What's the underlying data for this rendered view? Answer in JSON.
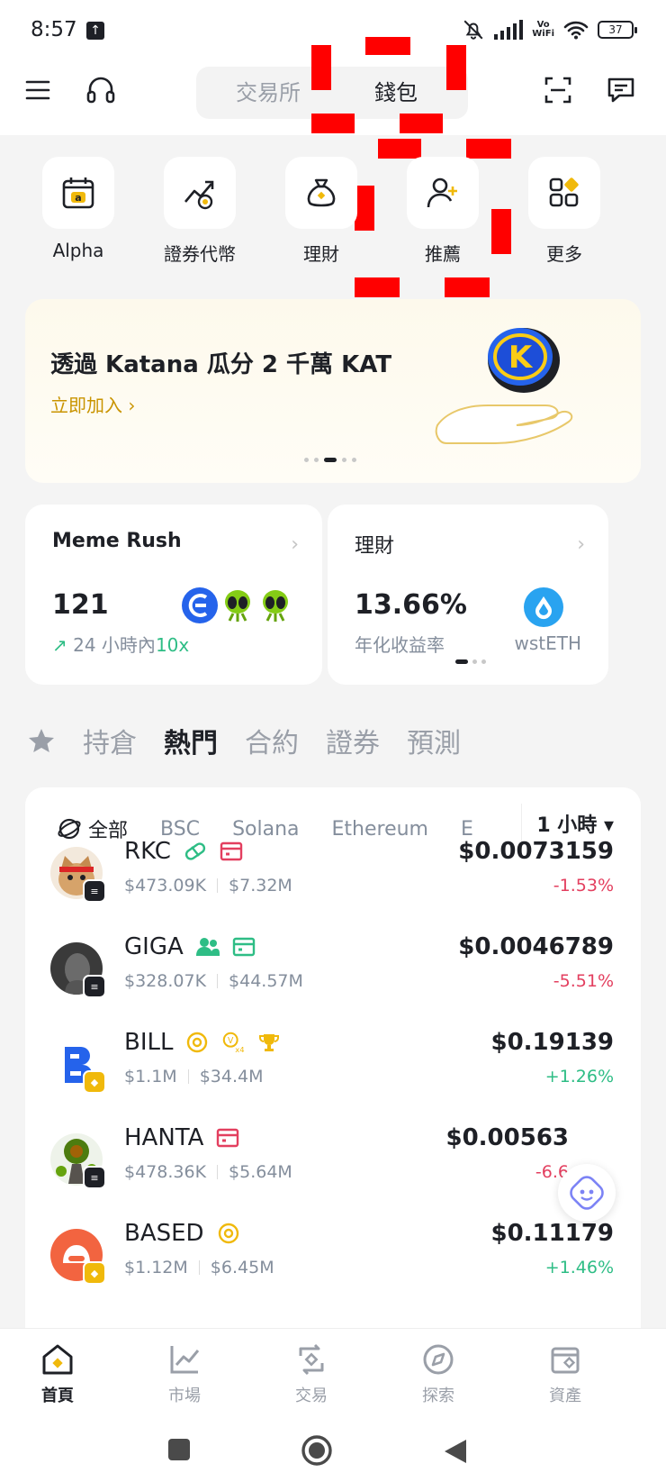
{
  "status_bar": {
    "time": "8:57",
    "vowifi_top": "Vo",
    "vowifi_bottom": "WiFi",
    "battery": "37"
  },
  "header": {
    "tabs": [
      "交易所",
      "錢包"
    ],
    "active_tab": "錢包"
  },
  "shortcuts": [
    {
      "label": "Alpha",
      "icon": "calendar-alpha-icon"
    },
    {
      "label": "證券代幣",
      "icon": "chart-coin-icon"
    },
    {
      "label": "理財",
      "icon": "money-bag-icon"
    },
    {
      "label": "推薦",
      "icon": "add-user-icon"
    },
    {
      "label": "更多",
      "icon": "grid-more-icon"
    }
  ],
  "banner": {
    "title": "透過 Katana 瓜分 2 千萬 KAT",
    "cta": "立即加入",
    "logo_letter": "K"
  },
  "cards": {
    "meme": {
      "title": "Meme Rush",
      "value": "121",
      "sub_prefix": "24 小時內",
      "sub_highlight": "10x"
    },
    "earn": {
      "title": "理財",
      "value": "13.66%",
      "sub": "年化收益率",
      "asset": "wstETH"
    }
  },
  "tabs": [
    "持倉",
    "熱門",
    "合約",
    "證券",
    "預測"
  ],
  "active_tab": "熱門",
  "chains": [
    "全部",
    "BSC",
    "Solana",
    "Ethereum",
    "E"
  ],
  "time_filter": "1 小時",
  "tokens": [
    {
      "symbol": "RKC",
      "vol": "$473.09K",
      "mcap": "$7.32M",
      "price": "$0.0073159",
      "change": "-1.53%",
      "direction": "down",
      "chain": "solana"
    },
    {
      "symbol": "GIGA",
      "vol": "$328.07K",
      "mcap": "$44.57M",
      "price": "$0.0046789",
      "change": "-5.51%",
      "direction": "down",
      "chain": "solana"
    },
    {
      "symbol": "BILL",
      "vol": "$1.1M",
      "mcap": "$34.4M",
      "price": "$0.19139",
      "change": "+1.26%",
      "direction": "up",
      "chain": "bsc"
    },
    {
      "symbol": "HANTA",
      "vol": "$478.36K",
      "mcap": "$5.64M",
      "price": "$0.00563",
      "change": "-6.6",
      "direction": "down",
      "chain": "solana"
    },
    {
      "symbol": "BASED",
      "vol": "$1.12M",
      "mcap": "$6.45M",
      "price": "$0.11179",
      "change": "+1.46%",
      "direction": "up",
      "chain": "bsc"
    }
  ],
  "bottom_nav": [
    {
      "label": "首頁",
      "icon": "home-icon"
    },
    {
      "label": "市場",
      "icon": "market-chart-icon"
    },
    {
      "label": "交易",
      "icon": "trade-swap-icon"
    },
    {
      "label": "探索",
      "icon": "explore-compass-icon"
    },
    {
      "label": "資產",
      "icon": "wallet-assets-icon"
    }
  ],
  "colors": {
    "brand": "#f0b90b",
    "up": "#2ebd85",
    "down": "#e33f5f",
    "cta": "#c99400"
  }
}
